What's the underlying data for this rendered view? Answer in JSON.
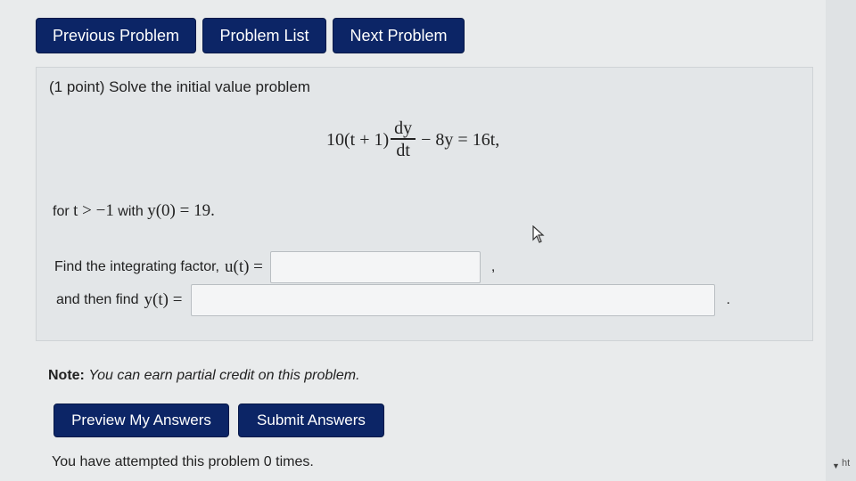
{
  "nav": {
    "previous_label": "Previous Problem",
    "list_label": "Problem List",
    "next_label": "Next Problem"
  },
  "problem": {
    "intro": "(1 point) Solve the initial value problem",
    "equation": {
      "lhs_prefix": "10(t + 1)",
      "frac_num": "dy",
      "frac_den": "dt",
      "rhs": "− 8y = 16t,"
    },
    "condition": {
      "text_for": "for",
      "math": "t > −1",
      "text_with": "with",
      "ic": "y(0) = 19."
    },
    "row1": {
      "label": "Find the integrating factor,",
      "math": "u(t) =",
      "input_value": "",
      "trailing": ","
    },
    "row2": {
      "label": "and then find",
      "math": "y(t) =",
      "input_value": "",
      "trailing": "."
    }
  },
  "note": {
    "label": "Note:",
    "text": "You can earn partial credit on this problem."
  },
  "actions": {
    "preview_label": "Preview My Answers",
    "submit_label": "Submit Answers"
  },
  "status": {
    "attempts": "You have attempted this problem 0 times."
  },
  "corner": {
    "text": "ht"
  },
  "colors": {
    "button_bg": "#0c2566",
    "page_bg": "#e9ebec",
    "box_bg": "#e3e6e8"
  },
  "icons": {
    "cursor": "mouse-pointer-icon",
    "scroll": "scroll-down-arrow-icon"
  }
}
